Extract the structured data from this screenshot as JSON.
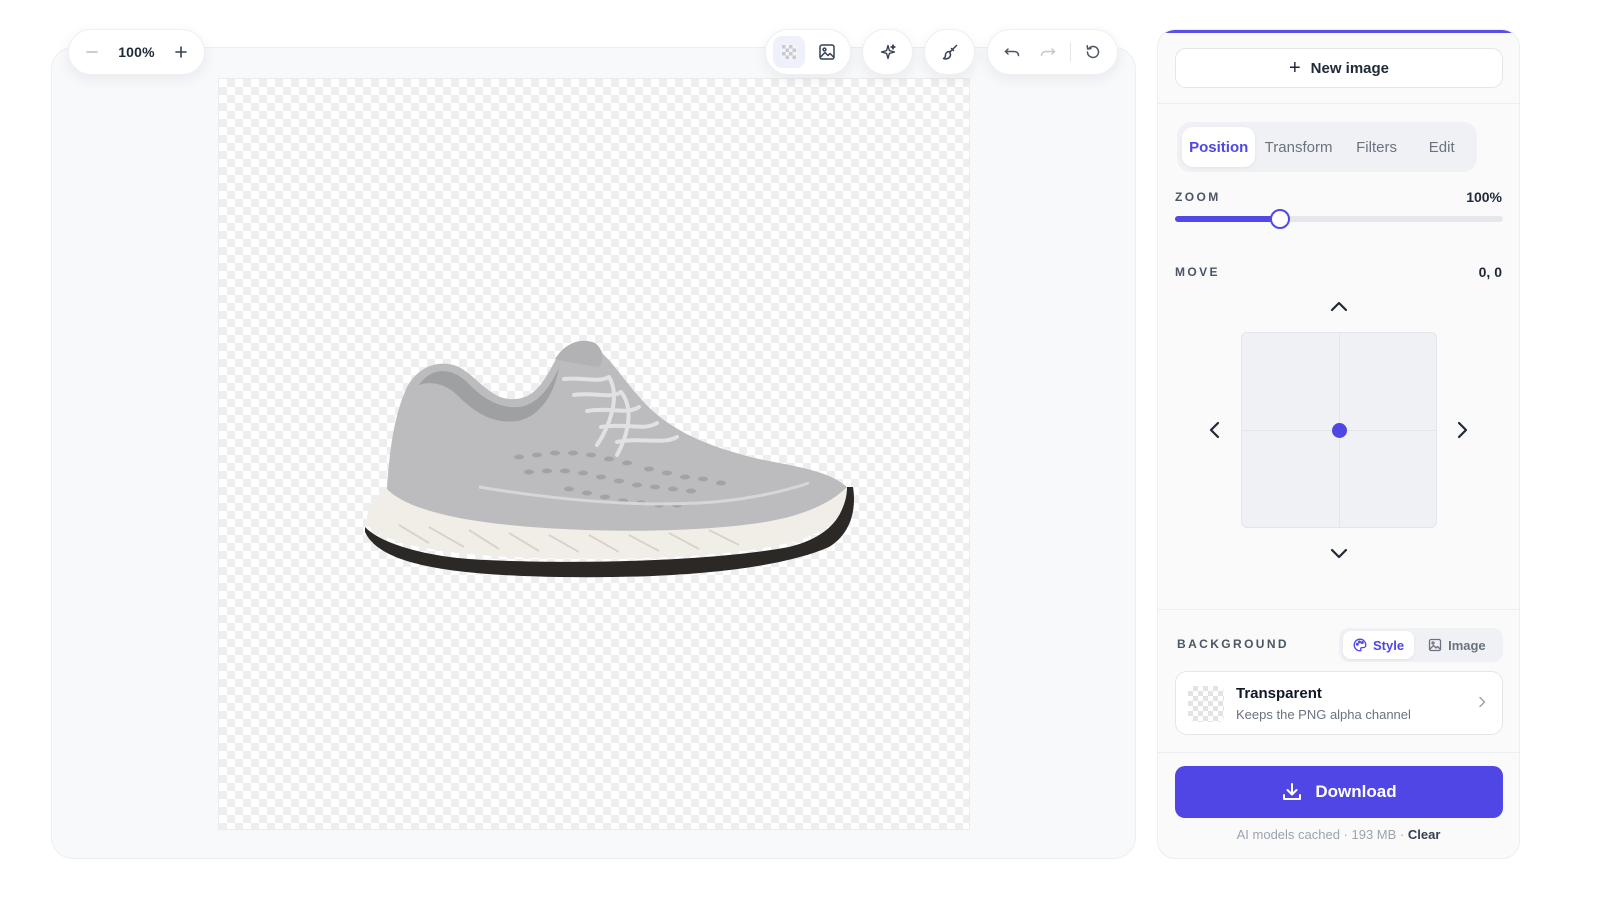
{
  "canvas": {
    "zoom_label": "100%",
    "zoom_out_icon": "minus",
    "zoom_in_icon": "plus",
    "toolbar_icons": [
      "transparency-grid-icon",
      "image-icon",
      "sparkle-icon",
      "brush-icon",
      "undo-icon",
      "redo-icon",
      "reset-icon"
    ],
    "subject_colors": {
      "upper": "#b9b9bb",
      "sole": "#f2efea",
      "outsole": "#2a2826"
    }
  },
  "panel": {
    "accent_color": "#4f46e5",
    "new_image_label": "New image",
    "tabs": [
      {
        "label": "Position",
        "active": true
      },
      {
        "label": "Transform",
        "active": false
      },
      {
        "label": "Filters",
        "active": false
      },
      {
        "label": "Edit",
        "active": false
      }
    ],
    "zoom": {
      "label": "ZOOM",
      "value_text": "100%",
      "level": 0.32
    },
    "move": {
      "label": "MOVE",
      "value_text": "0, 0",
      "x": 0,
      "y": 0
    },
    "background": {
      "label": "BACKGROUND",
      "options": [
        {
          "label": "Style",
          "icon": "palette-icon",
          "active": true
        },
        {
          "label": "Image",
          "icon": "image-icon",
          "active": false
        }
      ],
      "selected_title": "Transparent",
      "selected_subtitle": "Keeps the PNG alpha channel"
    },
    "download_label": "Download",
    "footer": {
      "text": "AI models cached · 193 MB · ",
      "clear_label": "Clear"
    }
  }
}
